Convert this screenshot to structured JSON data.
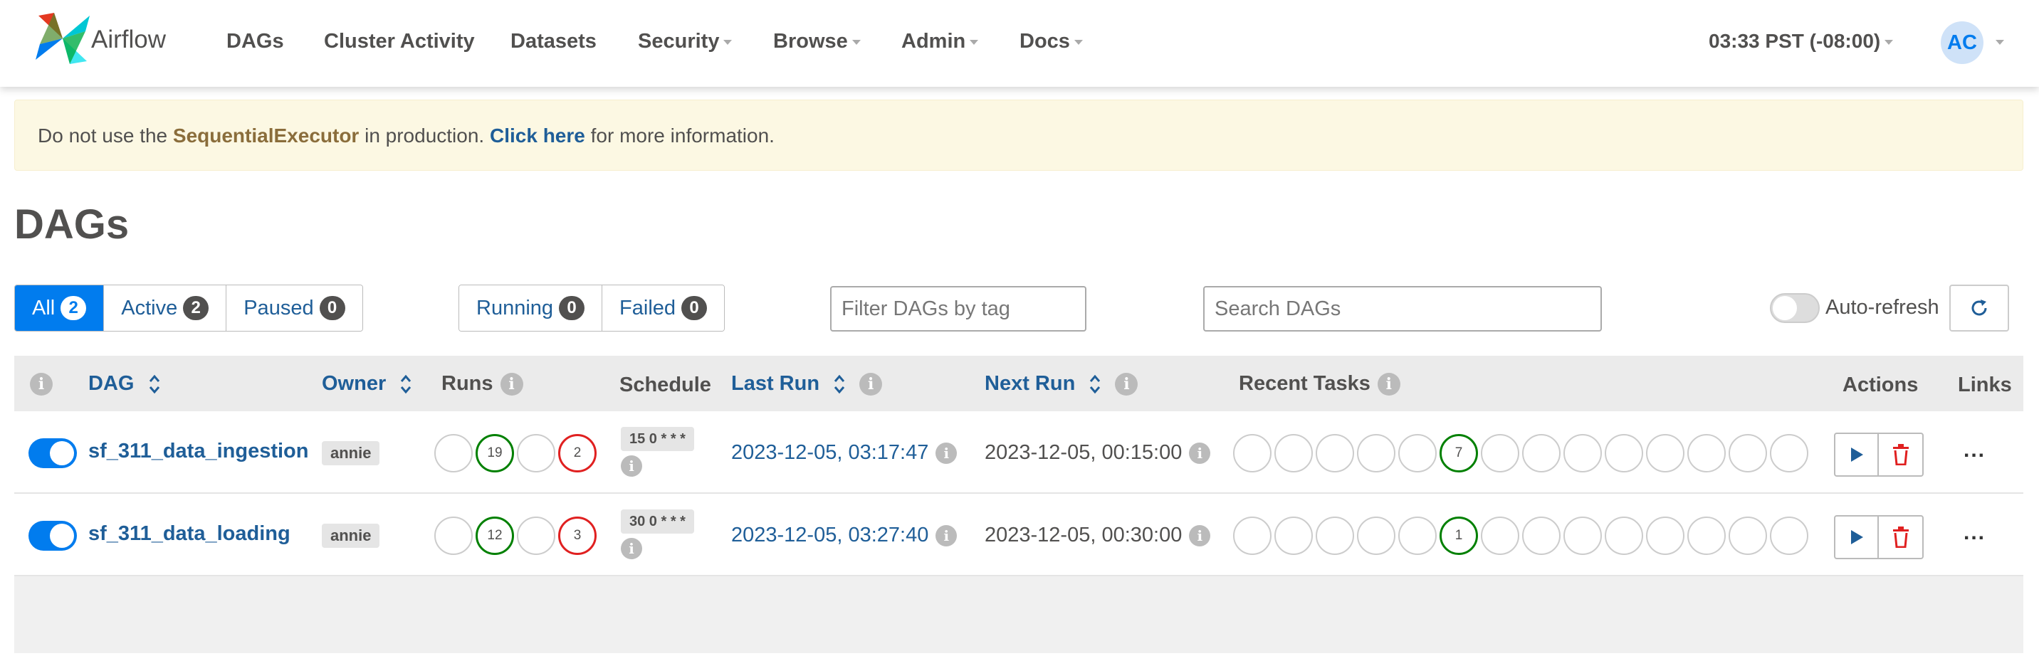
{
  "nav": {
    "brand": "Airflow",
    "items": [
      "DAGs",
      "Cluster Activity",
      "Datasets",
      "Security",
      "Browse",
      "Admin",
      "Docs"
    ],
    "clock": "03:33 PST (-08:00)",
    "avatar_initials": "AC"
  },
  "alert": {
    "prefix": "Do not use the ",
    "executor": "SequentialExecutor",
    "middle": " in production. ",
    "link": "Click here",
    "suffix": " for more information."
  },
  "page_title": "DAGs",
  "filters": {
    "all_label": "All",
    "all_count": "2",
    "active_label": "Active",
    "active_count": "2",
    "paused_label": "Paused",
    "paused_count": "0",
    "running_label": "Running",
    "running_count": "0",
    "failed_label": "Failed",
    "failed_count": "0",
    "tag_placeholder": "Filter DAGs by tag",
    "search_placeholder": "Search DAGs",
    "auto_refresh": "Auto-refresh"
  },
  "table": {
    "headers": {
      "dag": "DAG",
      "owner": "Owner",
      "runs": "Runs",
      "schedule": "Schedule",
      "last_run": "Last Run",
      "next_run": "Next Run",
      "recent_tasks": "Recent Tasks",
      "actions": "Actions",
      "links": "Links"
    },
    "rows": [
      {
        "name": "sf_311_data_ingestion",
        "owner": "annie",
        "runs": [
          "",
          "19",
          "",
          "2"
        ],
        "schedule": "15 0 * * *",
        "last_run": "2023-12-05, 03:17:47",
        "next_run": "2023-12-05, 00:15:00",
        "recent_success": "7"
      },
      {
        "name": "sf_311_data_loading",
        "owner": "annie",
        "runs": [
          "",
          "12",
          "",
          "3"
        ],
        "schedule": "30 0 * * *",
        "last_run": "2023-12-05, 03:27:40",
        "next_run": "2023-12-05, 00:30:00",
        "recent_success": "1"
      }
    ],
    "more_label": "..."
  },
  "icons": {
    "info": "info-icon",
    "sort": "sort-icon",
    "play": "play-icon",
    "trash": "trash-icon",
    "refresh": "refresh-icon"
  },
  "colors": {
    "primary": "#017cee",
    "link": "#1f5e98",
    "success": "#008000",
    "failed": "#e02020"
  }
}
